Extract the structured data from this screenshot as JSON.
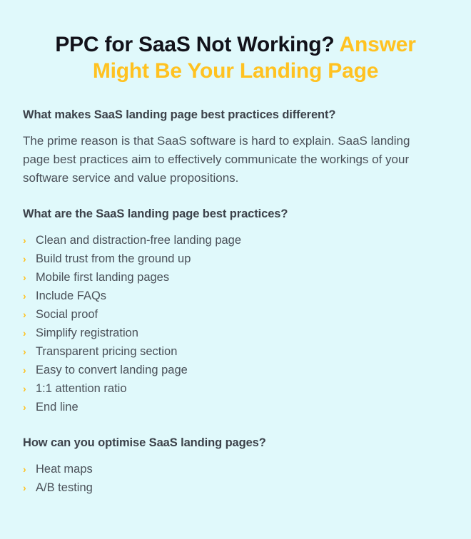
{
  "article": {
    "title": {
      "lead": "PPC for SaaS Not Working?",
      "accent": "Answer Might Be Your Landing Page"
    },
    "colors": {
      "background": "#e0f9fb",
      "accent": "#ffc221",
      "heading": "#3c424a",
      "body_text": "#4a5058",
      "title_lead": "#12121a"
    },
    "sections": [
      {
        "heading": "What makes SaaS landing page best practices different?",
        "paragraph": "The prime reason is that SaaS software is hard to explain. SaaS landing page best practices aim to effectively communicate the workings of your software service and value propositions.",
        "items": []
      },
      {
        "heading": "What are the SaaS landing page best practices?",
        "paragraph": "",
        "items": [
          "Clean and distraction-free landing page",
          "Build trust from the ground up",
          "Mobile first landing pages",
          "Include FAQs",
          "Social proof",
          "Simplify registration",
          "Transparent pricing section",
          "Easy to convert landing page",
          "1:1 attention ratio",
          "End line"
        ]
      },
      {
        "heading": "How can you optimise SaaS landing pages?",
        "paragraph": "",
        "items": [
          "Heat maps",
          "A/B testing"
        ]
      }
    ],
    "bullet_icon": "›"
  }
}
